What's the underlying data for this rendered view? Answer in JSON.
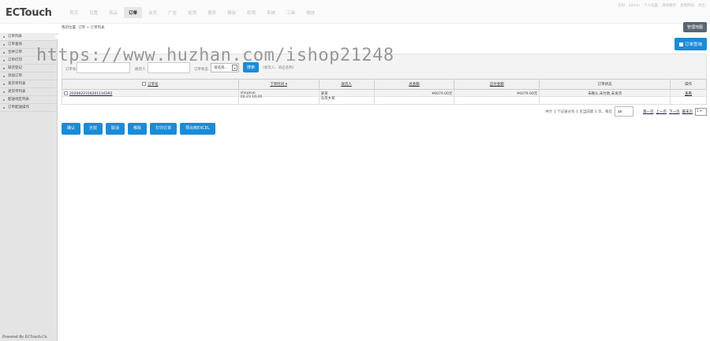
{
  "brand": {
    "logo": "ECTouch"
  },
  "nav": {
    "items": [
      "首页",
      "设置",
      "商品",
      "订单",
      "会员",
      "广告",
      "促销",
      "报表",
      "模板",
      "权限",
      "系统",
      "工具",
      "微信"
    ],
    "active": "订单"
  },
  "top_links": [
    "您好：admin",
    "个人设置",
    "清除缓存",
    "查看网站",
    "退出"
  ],
  "manage_button": "管理地图",
  "sidebar": {
    "items": [
      "订单列表",
      "订单查询",
      "合并订单",
      "订单打印",
      "缺货登记",
      "添加订单",
      "发货单列表",
      "退货单列表",
      "配送地区列表",
      "订单配送操作"
    ],
    "footer": "Powered By ECTouch.Cn"
  },
  "breadcrumb": "我的位置: 订单 > 订单列表",
  "query_button": "订单查询",
  "filter": {
    "order_label": "订单号",
    "consignee_label": "收货人",
    "status_label": "订单状态",
    "status_value": "请选择...",
    "search_button": "搜索",
    "hint": "(收货人、商品名称)"
  },
  "watermark": "https://www.huzhan.com/ishop21248",
  "table": {
    "headers": [
      "订单号",
      "下单时间",
      "收货人",
      "总金额",
      "应付金额",
      "订单状态",
      "操作"
    ],
    "rows": [
      {
        "order_no": "2020022316201116392",
        "buyer": "shoukuo",
        "time": "02-23 16:20",
        "consignee": "某某",
        "address": "东风乡某",
        "total": "¥6079.00元",
        "payable": "¥6079.00元",
        "status": "未确认,未付款,未发货",
        "action": "查看"
      }
    ]
  },
  "pager": {
    "summary": "共计 1 个记录分为 1 页当前第 1 页，每页",
    "per_page": "15",
    "first": "第一页",
    "prev": "上一页",
    "next": "下一页",
    "last": "最末页",
    "page_select": "1"
  },
  "actions": [
    "确认",
    "无效",
    "取消",
    "移除",
    "打印订单",
    "导出到EXCEL"
  ]
}
